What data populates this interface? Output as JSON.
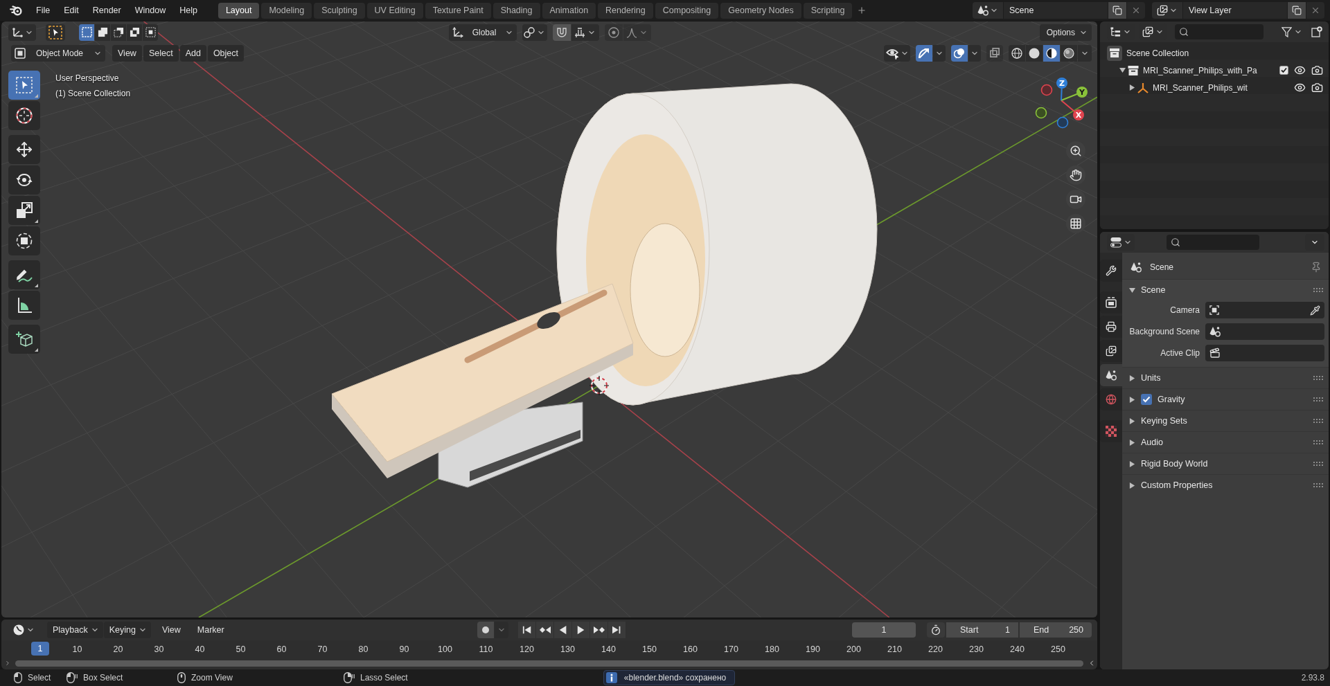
{
  "top_bar": {
    "menus": [
      "File",
      "Edit",
      "Render",
      "Window",
      "Help"
    ],
    "workspaces": [
      {
        "label": "Layout",
        "selected": true
      },
      {
        "label": "Modeling",
        "selected": false
      },
      {
        "label": "Sculpting",
        "selected": false
      },
      {
        "label": "UV Editing",
        "selected": false
      },
      {
        "label": "Texture Paint",
        "selected": false
      },
      {
        "label": "Shading",
        "selected": false
      },
      {
        "label": "Animation",
        "selected": false
      },
      {
        "label": "Rendering",
        "selected": false
      },
      {
        "label": "Compositing",
        "selected": false
      },
      {
        "label": "Geometry Nodes",
        "selected": false
      },
      {
        "label": "Scripting",
        "selected": false
      }
    ],
    "scene": "Scene",
    "view_layer": "View Layer"
  },
  "viewport": {
    "header": {
      "select_modes": [
        {
          "selected": true
        },
        {
          "selected": false
        },
        {
          "selected": false
        },
        {
          "selected": false
        },
        {
          "selected": false
        }
      ],
      "orientation": "Global",
      "options": "Options",
      "mode": "Object Mode",
      "menus": [
        "View",
        "Select",
        "Add",
        "Object"
      ],
      "gizmos_on": true,
      "overlays_on": true,
      "xray_on": false,
      "shading_modes": [
        {
          "selected": false
        },
        {
          "selected": false
        },
        {
          "selected": true
        },
        {
          "selected": false
        }
      ]
    },
    "info": [
      "User Perspective",
      "(1) Scene Collection"
    ],
    "tools": [
      {
        "selected": true
      },
      {
        "selected": false
      },
      {
        "selected": false
      },
      {
        "selected": false
      },
      {
        "selected": false
      },
      {
        "selected": false
      },
      {
        "selected": false
      },
      {
        "selected": false
      },
      {
        "selected": false
      }
    ],
    "gizmo_axes": [
      "X",
      "Y",
      "Z"
    ]
  },
  "outliner": {
    "tree": [
      {
        "label": "Scene Collection",
        "kind": "scene_collection",
        "children": [
          {
            "label": "MRI_Scanner_Philips_with_Pa",
            "kind": "collection",
            "expanded": true,
            "checked": true,
            "visible": true,
            "renderable": true,
            "children": [
              {
                "label": "MRI_Scanner_Philips_wit",
                "kind": "object",
                "expanded": false,
                "visible": true,
                "renderable": true
              }
            ]
          }
        ]
      }
    ]
  },
  "properties": {
    "tabs": [
      {
        "selected": false
      },
      {
        "selected": false
      },
      {
        "selected": false
      },
      {
        "selected": false
      },
      {
        "selected": true
      },
      {
        "selected": false
      },
      {
        "selected": false
      }
    ],
    "context": "Scene",
    "panels": [
      {
        "label": "Scene",
        "expanded": true,
        "fields": [
          {
            "label": "Camera"
          },
          {
            "label": "Background Scene"
          },
          {
            "label": "Active Clip"
          }
        ]
      },
      {
        "label": "Units",
        "expanded": false
      },
      {
        "label": "Gravity",
        "expanded": false,
        "checked": true
      },
      {
        "label": "Keying Sets",
        "expanded": false
      },
      {
        "label": "Audio",
        "expanded": false
      },
      {
        "label": "Rigid Body World",
        "expanded": false
      },
      {
        "label": "Custom Properties",
        "expanded": false
      }
    ]
  },
  "timeline": {
    "dropdowns": [
      "Playback",
      "Keying"
    ],
    "menus": [
      "View",
      "Marker"
    ],
    "auto_keying": false,
    "current_frame": "1",
    "start_label": "Start",
    "start": "1",
    "end_label": "End",
    "end": "250",
    "playhead": "1",
    "ruler": [
      "10",
      "20",
      "30",
      "40",
      "50",
      "60",
      "70",
      "80",
      "90",
      "100",
      "110",
      "120",
      "130",
      "140",
      "150",
      "160",
      "170",
      "180",
      "190",
      "200",
      "210",
      "220",
      "230",
      "240",
      "250"
    ]
  },
  "status_bar": {
    "hints": [
      "Select",
      "Box Select",
      "Zoom View",
      "Lasso Select"
    ],
    "message": "«blender.blend» сохранено",
    "version": "2.93.8"
  }
}
